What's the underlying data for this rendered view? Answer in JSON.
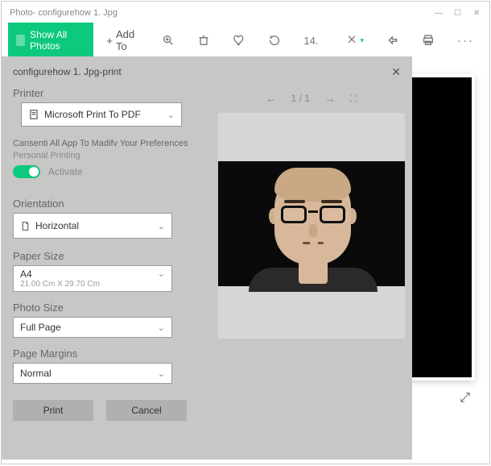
{
  "window": {
    "title": "Photo- configurehow 1. Jpg"
  },
  "toolbar": {
    "show_all": "Show All Photos",
    "add_to": "Add To",
    "num": "14."
  },
  "dialog": {
    "title": "configurehow 1. Jpg-print",
    "printer_label": "Printer",
    "printer_value": "Microsoft Print To PDF",
    "consent_line1": "Cansenti All App To Madifv Your Preferences",
    "consent_line2": "Personal Printing",
    "activate": "Activate",
    "orientation_label": "Orientation",
    "orientation_value": "Horizontal",
    "paper_label": "Paper Size",
    "paper_value": "A4",
    "paper_sub": "21.00 Cm X 29.70 Cm",
    "photo_label": "Photo Size",
    "photo_value": "Full Page",
    "margins_label": "Page Margins",
    "margins_value": "Normal",
    "print_btn": "Print",
    "cancel_btn": "Cancel",
    "pager": "1 / 1"
  }
}
